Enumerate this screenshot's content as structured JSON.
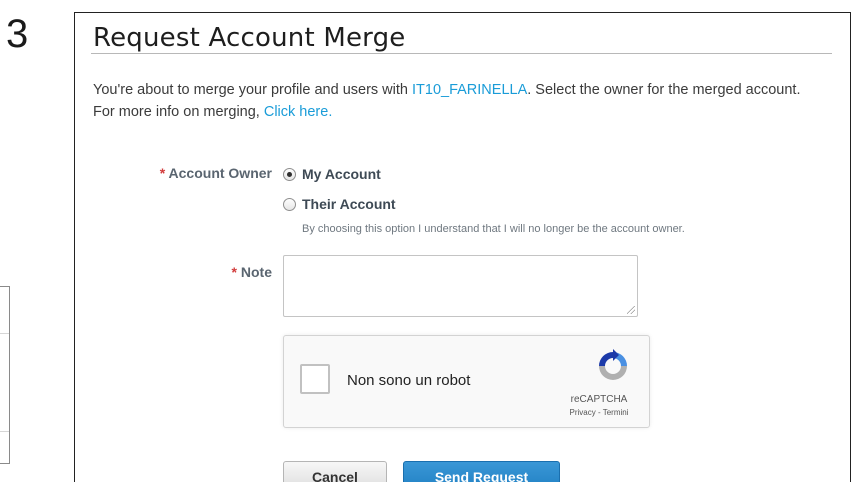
{
  "step_number": "3",
  "dialog": {
    "title": "Request Account Merge",
    "intro_prefix": "You're about to merge your profile and users with ",
    "intro_account_link": "IT10_FARINELLA",
    "intro_middle": ". Select the owner for the merged account. For more info on merging, ",
    "intro_help_link": "Click here."
  },
  "form": {
    "required_marker": "*",
    "owner_label": "Account Owner",
    "owner_options": [
      {
        "label": "My Account",
        "checked": true
      },
      {
        "label": "Their Account",
        "checked": false
      }
    ],
    "owner_hint": "By choosing this option I understand that I will no longer be the account owner.",
    "note_label": "Note",
    "note_value": ""
  },
  "captcha": {
    "checkbox_label": "Non sono un robot",
    "brand": "reCAPTCHA",
    "privacy": "Privacy",
    "separator": " - ",
    "terms": "Termini",
    "colors": {
      "blue": "#4a90e2",
      "gray": "#b0b0b0",
      "dark_blue": "#1c3aa9"
    }
  },
  "buttons": {
    "cancel": "Cancel",
    "send": "Send Request"
  }
}
